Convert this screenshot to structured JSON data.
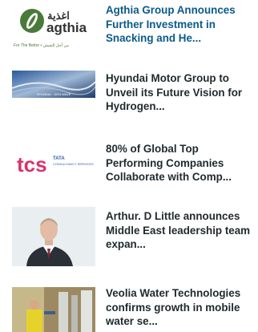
{
  "articles": [
    {
      "title": "Agthia Group Announces Further Investment in Snacking and He...",
      "thumb_icon": "agthia-logo",
      "logo_text": "agthia",
      "logo_arabic": "اغذية",
      "logo_tagline": "For The Better • من أجل التعيش"
    },
    {
      "title": "Hyundai Motor Group to Unveil its Future Vision for Hydrogen...",
      "thumb_icon": "hydrogen-wave-photo",
      "caption": "HYUNDAI · GEN WAVE"
    },
    {
      "title": "80% of Global Top Performing Companies Collaborate with Comp...",
      "thumb_icon": "tcs-logo",
      "logo_text": "tcs",
      "logo_brand": "TATA",
      "logo_sub": "CONSULTANCY SERVICES"
    },
    {
      "title": "Arthur. D Little announces Middle East leadership team expan...",
      "thumb_icon": "portrait-photo"
    },
    {
      "title": "Veolia Water Technologies confirms growth in mobile water se...",
      "thumb_icon": "water-plant-photo"
    }
  ],
  "colors": {
    "title": "#1f2a2e",
    "agthia_green": "#4a7a3a",
    "tcs_blue": "#2d5fa8",
    "tcs_pink": "#d6336c",
    "hyundai_navy": "#1d3b66"
  }
}
